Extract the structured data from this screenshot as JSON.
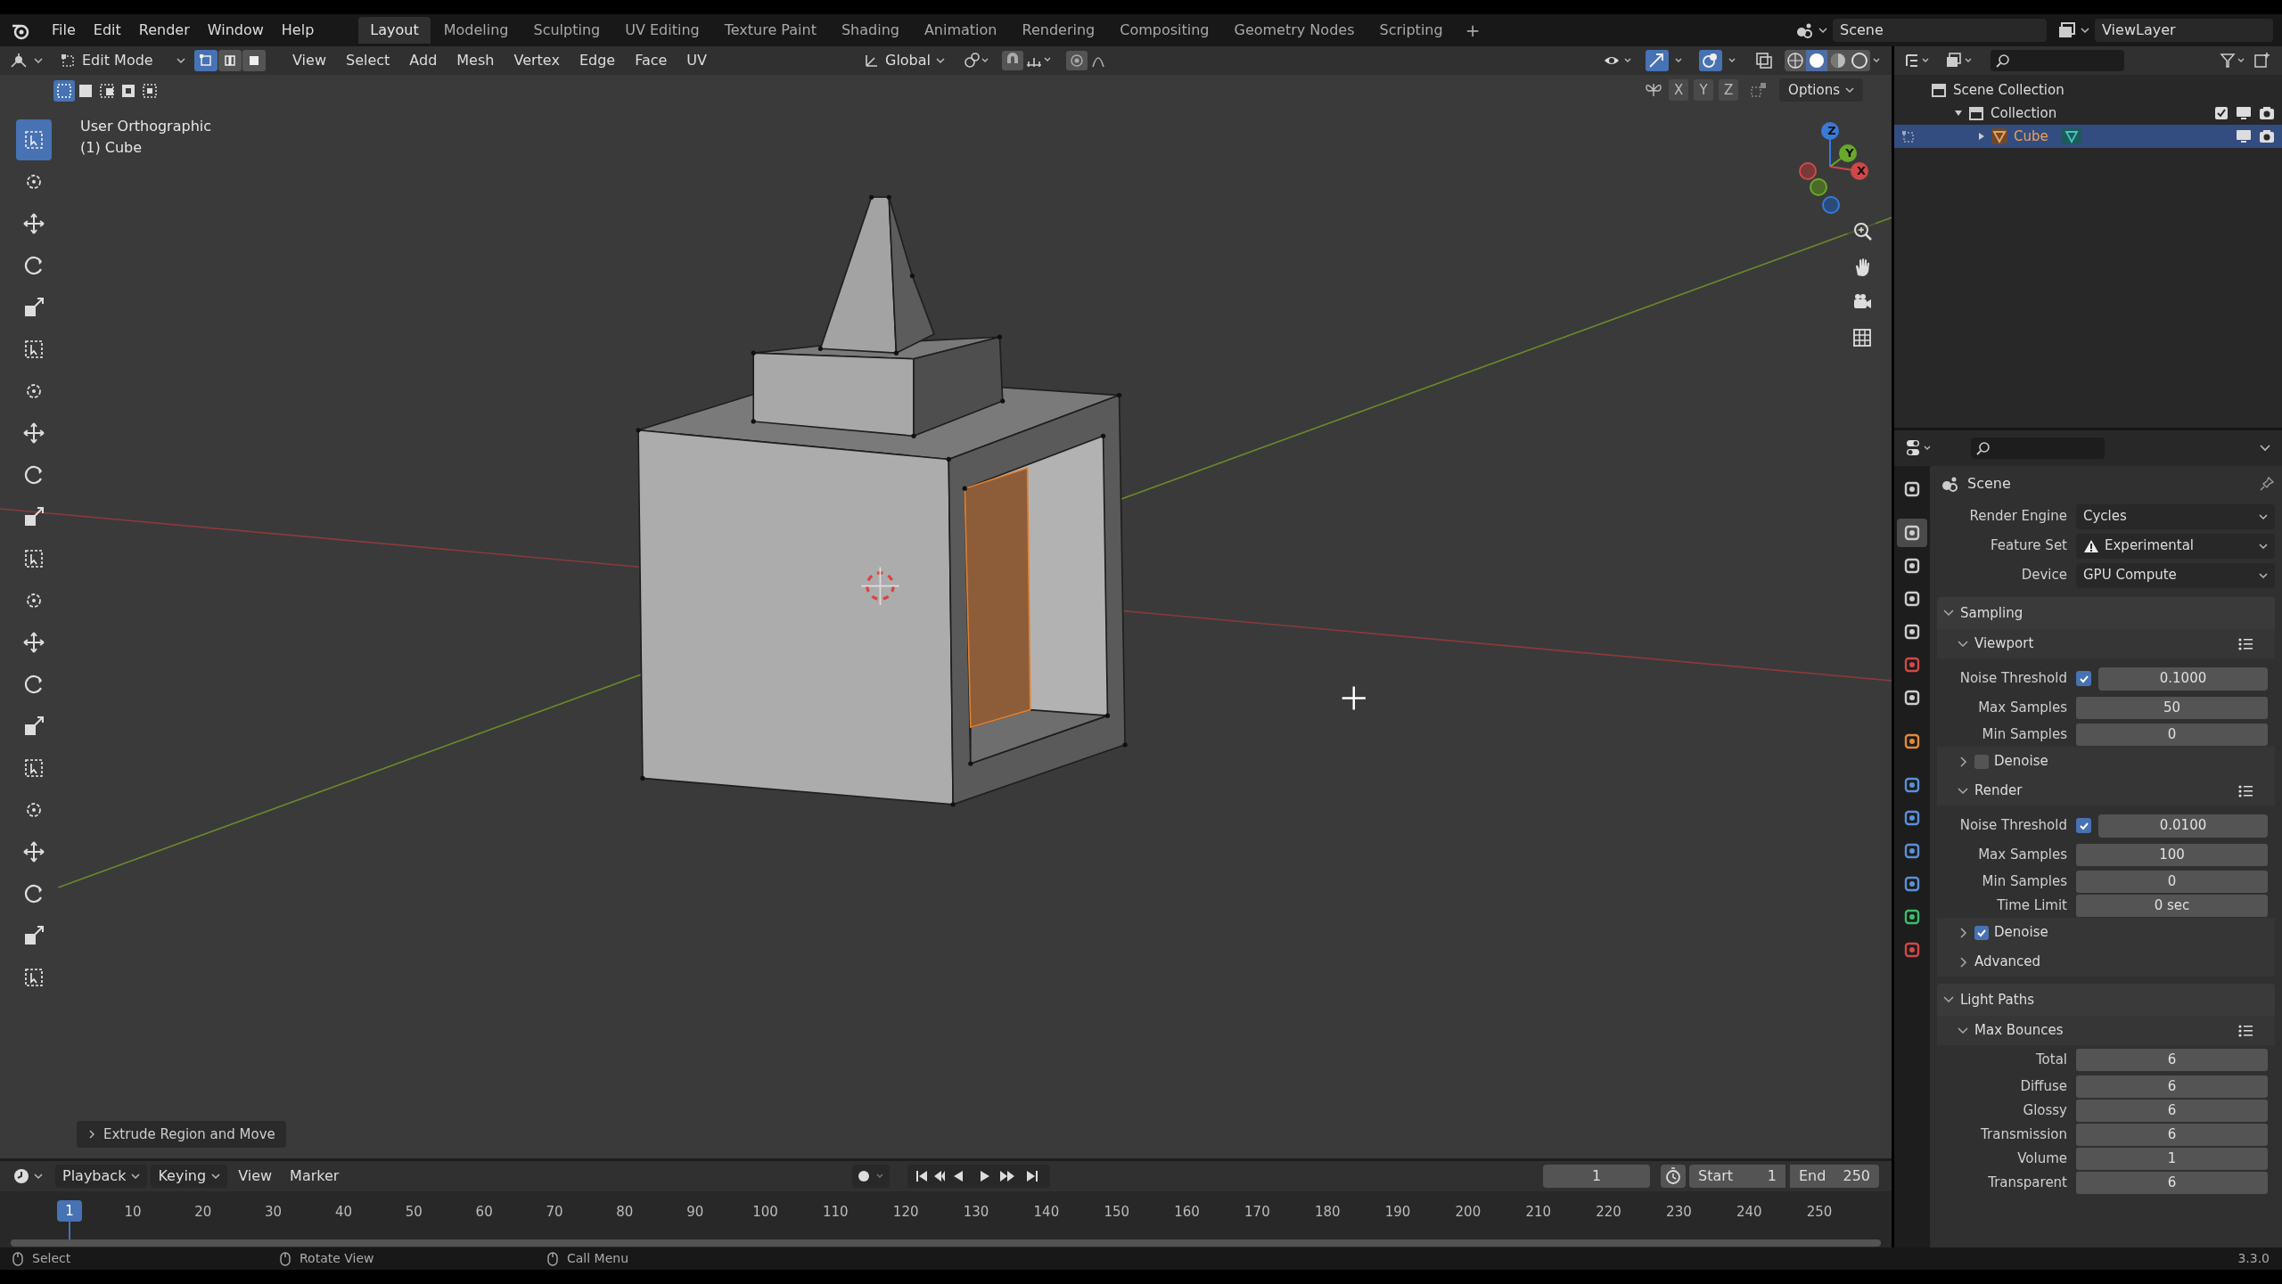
{
  "top_bar": {
    "menus": [
      "File",
      "Edit",
      "Render",
      "Window",
      "Help"
    ],
    "workspaces": [
      {
        "label": "Layout",
        "selected": true
      },
      {
        "label": "Modeling",
        "selected": false
      },
      {
        "label": "Sculpting",
        "selected": false
      },
      {
        "label": "UV Editing",
        "selected": false
      },
      {
        "label": "Texture Paint",
        "selected": false
      },
      {
        "label": "Shading",
        "selected": false
      },
      {
        "label": "Animation",
        "selected": false
      },
      {
        "label": "Rendering",
        "selected": false
      },
      {
        "label": "Compositing",
        "selected": false
      },
      {
        "label": "Geometry Nodes",
        "selected": false
      },
      {
        "label": "Scripting",
        "selected": false
      }
    ],
    "add_tab": "+",
    "scene": "Scene",
    "view_layer": "ViewLayer"
  },
  "viewport_header": {
    "mode": "Edit Mode",
    "select_modes": [
      {
        "selected": true
      },
      {
        "selected": false
      },
      {
        "selected": false
      }
    ],
    "menus": [
      "View",
      "Select",
      "Add",
      "Mesh",
      "Vertex",
      "Edge",
      "Face",
      "UV"
    ],
    "orientation": "Global",
    "axes": [
      "X",
      "Y",
      "Z"
    ],
    "options": "Options"
  },
  "viewport": {
    "view_name": "User Orthographic",
    "object_name": "(1) Cube",
    "last_operator": "Extrude Region and Move",
    "tools": [
      {
        "selected": true
      },
      {
        "selected": false
      },
      {
        "selected": false
      },
      {
        "selected": false
      },
      {
        "selected": false
      },
      {
        "selected": false
      },
      {
        "selected": false
      },
      {
        "selected": false
      },
      {
        "selected": false
      },
      {
        "selected": false
      },
      {
        "selected": false
      },
      {
        "selected": false
      },
      {
        "selected": false
      },
      {
        "selected": false
      },
      {
        "selected": false
      },
      {
        "selected": false
      },
      {
        "selected": false
      },
      {
        "selected": false
      },
      {
        "selected": false
      },
      {
        "selected": false
      },
      {
        "selected": false
      }
    ],
    "gizmo_axes": [
      "Z",
      "Y",
      "X"
    ]
  },
  "outliner": {
    "items": [
      {
        "label": "Scene Collection",
        "selected": false,
        "children": [
          {
            "label": "Collection",
            "selected": false,
            "expanded": true,
            "children": [
              {
                "label": "Cube",
                "selected": true,
                "expanded": false
              }
            ]
          }
        ]
      }
    ]
  },
  "properties": {
    "tabs": [
      {
        "selected": false,
        "color": "#cccccc"
      },
      {
        "selected": true,
        "color": "#cccccc"
      },
      {
        "selected": false,
        "color": "#cccccc"
      },
      {
        "selected": false,
        "color": "#cccccc"
      },
      {
        "selected": false,
        "color": "#cccccc"
      },
      {
        "selected": false,
        "color": "#d04848"
      },
      {
        "selected": false,
        "color": "#cccccc"
      },
      {
        "selected": false,
        "color": "#e08a3a"
      },
      {
        "selected": false,
        "color": "#5b8fd8"
      },
      {
        "selected": false,
        "color": "#5b8fd8"
      },
      {
        "selected": false,
        "color": "#5b8fd8"
      },
      {
        "selected": false,
        "color": "#5b8fd8"
      },
      {
        "selected": false,
        "color": "#3cbb6c"
      },
      {
        "selected": false,
        "color": "#d04848"
      }
    ],
    "context": "Scene",
    "rows": [
      {
        "kind": "dropdown",
        "label": "Render Engine",
        "value": "Cycles",
        "warning": false
      },
      {
        "kind": "dropdown",
        "label": "Feature Set",
        "value": "Experimental",
        "warning": true
      },
      {
        "kind": "dropdown",
        "label": "Device",
        "value": "GPU Compute",
        "warning": false
      },
      {
        "kind": "panel",
        "label": "Sampling",
        "expanded": true
      },
      {
        "kind": "subpanel",
        "label": "Viewport",
        "expanded": true
      },
      {
        "kind": "check_number",
        "label": "Noise Threshold",
        "checked": true,
        "value": "0.1000"
      },
      {
        "kind": "number",
        "label": "Max Samples",
        "value": "50"
      },
      {
        "kind": "number",
        "label": "Min Samples",
        "value": "0"
      },
      {
        "kind": "check_subpanel",
        "label": "Denoise",
        "expanded": false,
        "checked": false
      },
      {
        "kind": "subpanel",
        "label": "Render",
        "expanded": true
      },
      {
        "kind": "check_number",
        "label": "Noise Threshold",
        "checked": true,
        "value": "0.0100"
      },
      {
        "kind": "number",
        "label": "Max Samples",
        "value": "100"
      },
      {
        "kind": "number",
        "label": "Min Samples",
        "value": "0"
      },
      {
        "kind": "number",
        "label": "Time Limit",
        "value": "0 sec"
      },
      {
        "kind": "check_subpanel",
        "label": "Denoise",
        "expanded": false,
        "checked": true
      },
      {
        "kind": "subpanel",
        "label": "Advanced",
        "expanded": false
      },
      {
        "kind": "panel",
        "label": "Light Paths",
        "expanded": true
      },
      {
        "kind": "subpanel",
        "label": "Max Bounces",
        "expanded": true
      },
      {
        "kind": "number",
        "label": "Total",
        "value": "6"
      },
      {
        "kind": "number",
        "label": "Diffuse",
        "value": "6"
      },
      {
        "kind": "number",
        "label": "Glossy",
        "value": "6"
      },
      {
        "kind": "number",
        "label": "Transmission",
        "value": "6"
      },
      {
        "kind": "number",
        "label": "Volume",
        "value": "1"
      },
      {
        "kind": "number",
        "label": "Transparent",
        "value": "6"
      }
    ]
  },
  "timeline": {
    "menus": [
      "Playback",
      "Keying",
      "View",
      "Marker"
    ],
    "current_frame": "1",
    "start_label": "Start",
    "start": "1",
    "end_label": "End",
    "end": "250",
    "ticks": [
      "1",
      "10",
      "20",
      "30",
      "40",
      "50",
      "60",
      "70",
      "80",
      "90",
      "100",
      "110",
      "120",
      "130",
      "140",
      "150",
      "160",
      "170",
      "180",
      "190",
      "200",
      "210",
      "220",
      "230",
      "240",
      "250"
    ]
  },
  "status_bar": {
    "items": [
      "Select",
      "Rotate View",
      "Call Menu"
    ],
    "version": "3.3.0"
  }
}
